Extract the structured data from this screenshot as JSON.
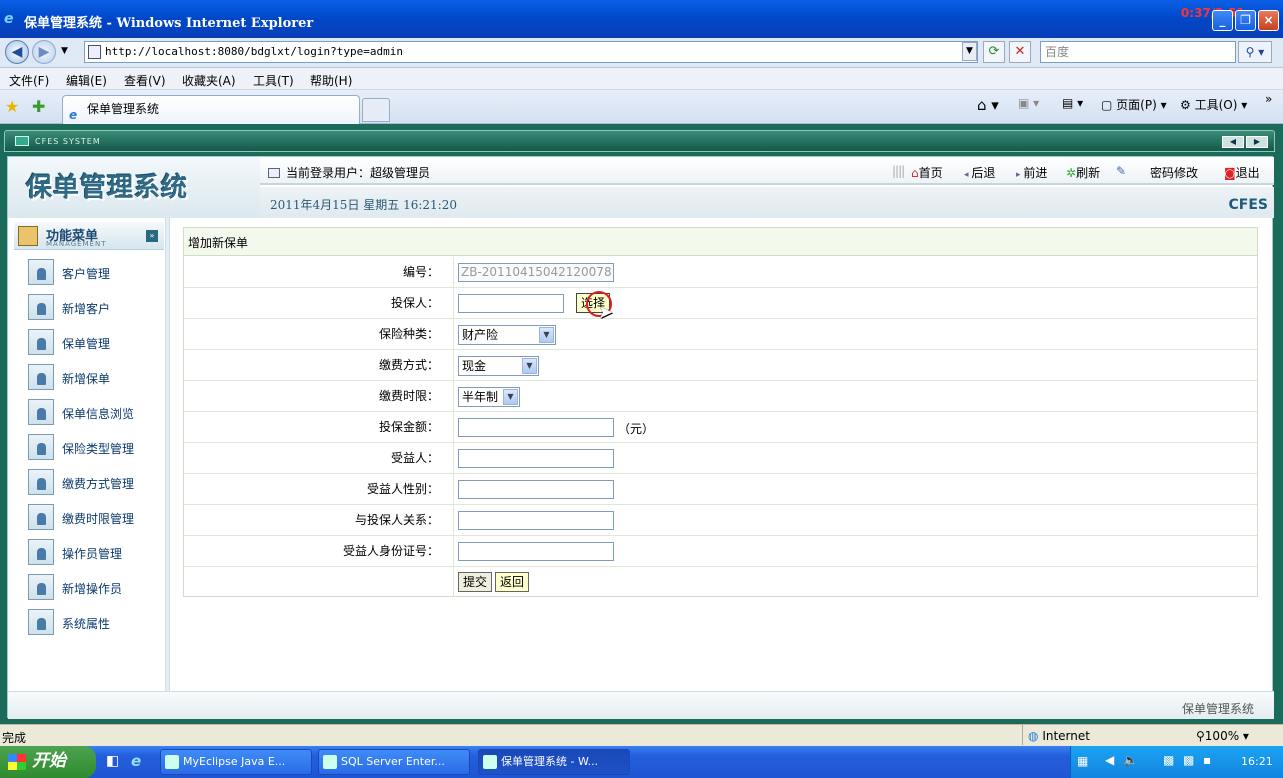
{
  "window": {
    "title": "保单管理系统 - Windows Internet Explorer",
    "clock_overlay": "0:37/2:51"
  },
  "address": {
    "url": "http://localhost:8080/bdglxt/login?type=admin",
    "search_placeholder": "百度"
  },
  "menubar": [
    "文件(F)",
    "编辑(E)",
    "查看(V)",
    "收藏夹(A)",
    "工具(T)",
    "帮助(H)"
  ],
  "tab": {
    "title": "保单管理系统",
    "page_menu": "页面(P)",
    "tools_menu": "工具(O)"
  },
  "app": {
    "banner_label": "CFES SYSTEM",
    "system_title": "保单管理系统",
    "current_user": "当前登录用户：超级管理员",
    "datetime": "2011年4月15日 星期五 16:21:20",
    "logo": "CFES",
    "links": {
      "home": "首页",
      "back": "后退",
      "forward": "前进",
      "refresh": "刷新",
      "password": "密码修改",
      "logout": "退出"
    },
    "menu_title": "功能菜单",
    "menu_subtitle": "MANAGEMENT",
    "sidebar": [
      "客户管理",
      "新增客户",
      "保单管理",
      "新增保单",
      "保单信息浏览",
      "保险类型管理",
      "缴费方式管理",
      "缴费时限管理",
      "操作员管理",
      "新增操作员",
      "系统属性"
    ],
    "footer": "保单管理系统"
  },
  "form": {
    "title": "增加新保单",
    "number_label": "编号：",
    "number_value": "ZB-20110415042120078",
    "insurer_label": "投保人：",
    "select_button": "选择",
    "type_label": "保险种类：",
    "type_value": "财产险",
    "pay_label": "缴费方式：",
    "pay_value": "现金",
    "term_label": "缴费时限：",
    "term_value": "半年制",
    "amount_label": "投保金额：",
    "amount_unit": "（元）",
    "beneficiary_label": "受益人：",
    "gender_label": "受益人性别：",
    "relation_label": "与投保人关系：",
    "id_label": "受益人身份证号：",
    "submit": "提交",
    "back": "返回"
  },
  "status": {
    "text": "完成",
    "zone": "Internet",
    "zoom": "100%"
  },
  "taskbar": {
    "start": "开始",
    "tasks": [
      "MyEclipse Java E...",
      "SQL Server Enter...",
      "保单管理系统 - W..."
    ],
    "time": "16:21"
  }
}
